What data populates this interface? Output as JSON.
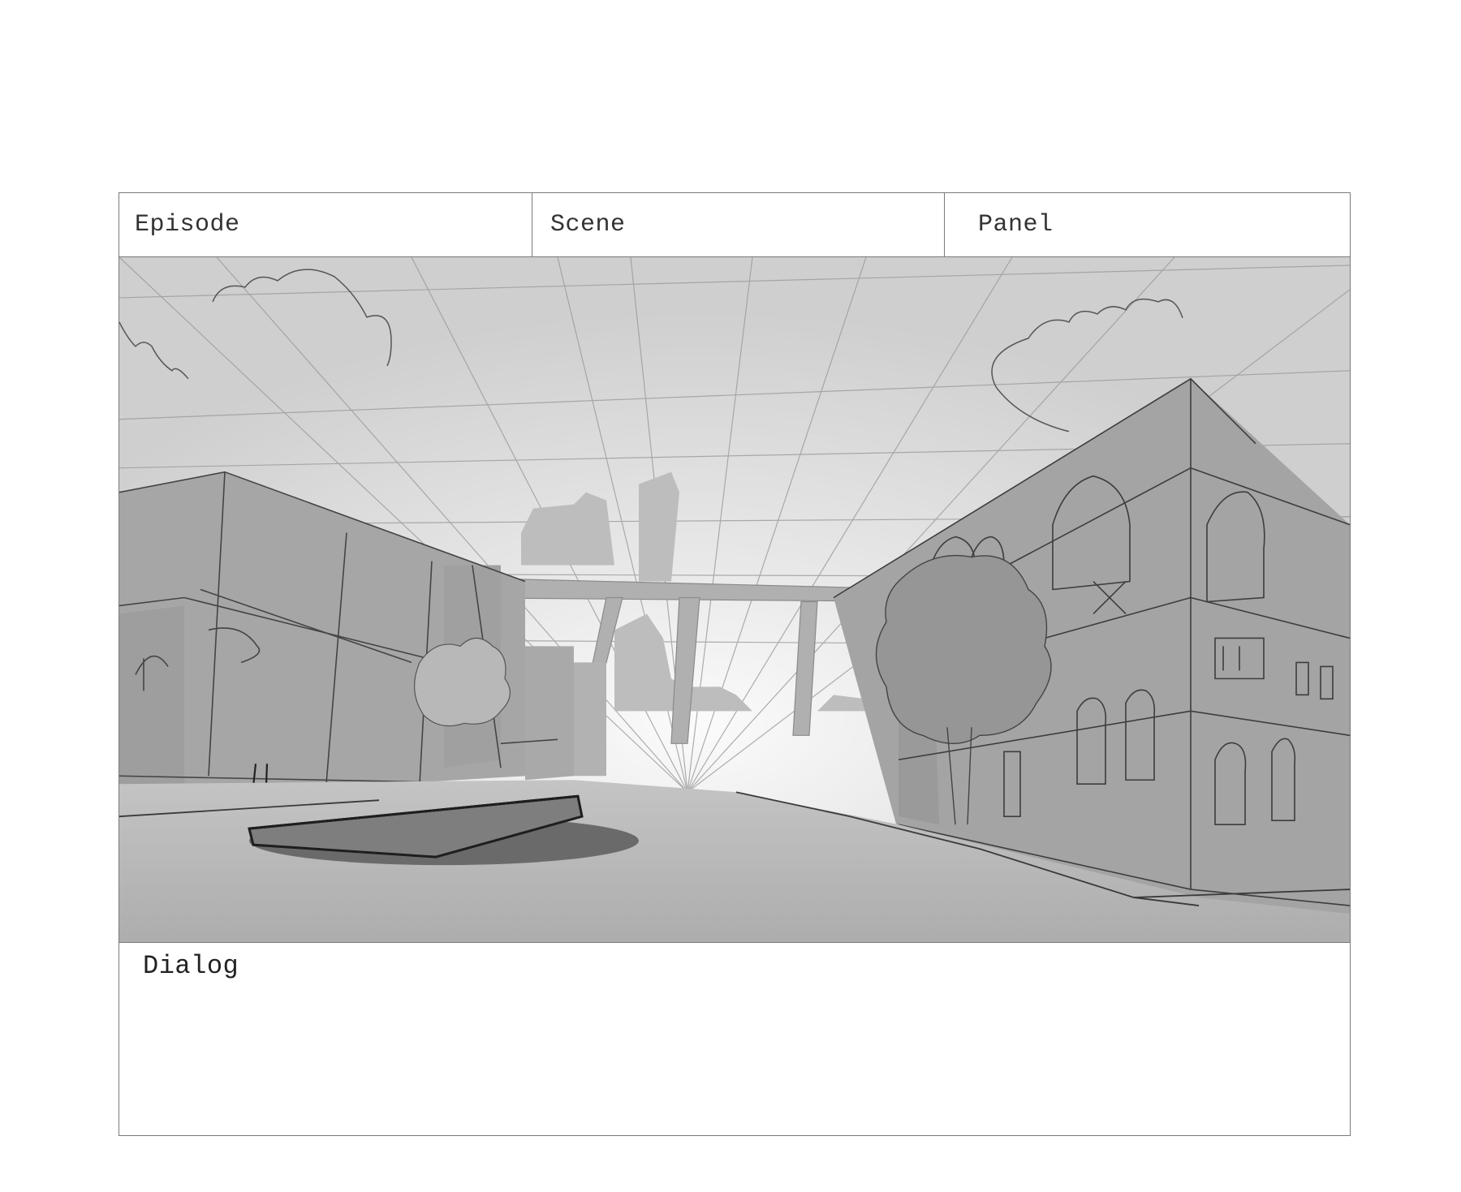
{
  "header": {
    "episode_label": "Episode",
    "scene_label": "Scene",
    "panel_label": "Panel"
  },
  "panel_image": {
    "subject": "storyboard-sketch-city-street"
  },
  "dialog": {
    "label": "Dialog"
  },
  "colors": {
    "border": "#7a7a7a",
    "sketch_bg_top": "#d0d0d0",
    "sketch_bg_light": "#f5f5f5",
    "building_fill": "#a8a8a8",
    "ground_fill": "#b4b4b4",
    "manhole_fill": "#6e6e6e",
    "line": "#3a3a3a"
  }
}
